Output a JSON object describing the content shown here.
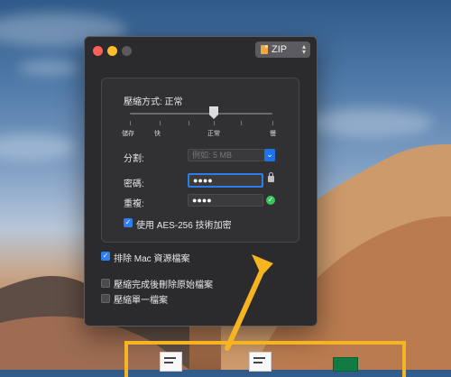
{
  "window": {
    "format_label": "ZIP",
    "compression_label": "壓縮方式: 正常",
    "slider": {
      "labels": [
        "儲存",
        "快",
        "正常",
        "慢"
      ],
      "selected_index": 3
    },
    "split": {
      "label": "分割:",
      "placeholder": "例如: 5 MB"
    },
    "password": {
      "label": "密碼:",
      "value": "●●●●"
    },
    "repeat": {
      "label": "重複:",
      "value": "●●●●"
    },
    "aes_label": "使用 AES-256 技術加密",
    "exclude_mac_label": "排除 Mac 資源檔案",
    "delete_original_label": "壓縮完成後刪除原始檔案",
    "single_archive_label": "壓縮單一檔案",
    "states": {
      "aes_checked": true,
      "exclude_mac_checked": true,
      "delete_original_checked": false,
      "single_archive_checked": false
    }
  },
  "colors": {
    "window_bg": "#2b2b2d",
    "accent_blue": "#2f7ff0",
    "highlight_orange": "#f6b322",
    "success_green": "#34c759"
  },
  "icons": [
    "zip-file-icon",
    "chevron-updown-icon",
    "lock-icon",
    "checkmark-icon",
    "document-icon",
    "spreadsheet-icon",
    "arrow-icon"
  ]
}
